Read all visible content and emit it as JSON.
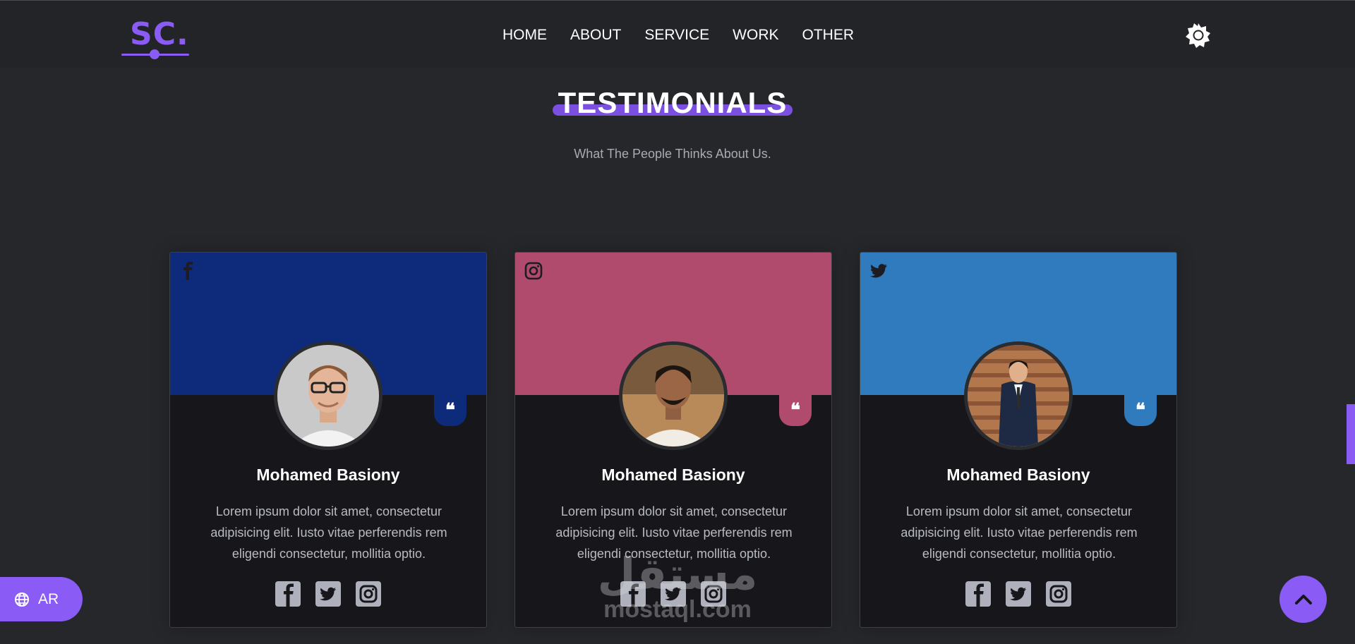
{
  "header": {
    "logo_text": "SC.",
    "nav": [
      "HOME",
      "ABOUT",
      "SERVICE",
      "WORK",
      "OTHER"
    ],
    "theme_icon": "sun-gear-icon"
  },
  "section": {
    "title": "TESTIMONIALS",
    "subtitle": "What The People Thinks About Us."
  },
  "cards": [
    {
      "platform_icon": "facebook-icon",
      "color": "#0e2a7a",
      "name": "Mohamed Basiony",
      "text": "Lorem ipsum dolor sit amet, consectetur adipisicing elit. Iusto vitae perferendis rem eligendi consectetur, mollitia optio."
    },
    {
      "platform_icon": "instagram-icon",
      "color": "#b04b6e",
      "name": "Mohamed Basiony",
      "text": "Lorem ipsum dolor sit amet, consectetur adipisicing elit. Iusto vitae perferendis rem eligendi consectetur, mollitia optio."
    },
    {
      "platform_icon": "twitter-icon",
      "color": "#2f7bbd",
      "name": "Mohamed Basiony",
      "text": "Lorem ipsum dolor sit amet, consectetur adipisicing elit. Iusto vitae perferendis rem eligendi consectetur, mollitia optio."
    }
  ],
  "quote_mark": "❝",
  "lang_button": {
    "label": "AR",
    "icon": "globe-icon"
  },
  "scroll_top": {
    "icon": "chevron-up-icon"
  },
  "watermark": {
    "arabic": "مستقل",
    "latin": "mostaql.com"
  },
  "colors": {
    "accent": "#8a5cf5",
    "background": "#26272b",
    "card_bg": "#17171b"
  }
}
